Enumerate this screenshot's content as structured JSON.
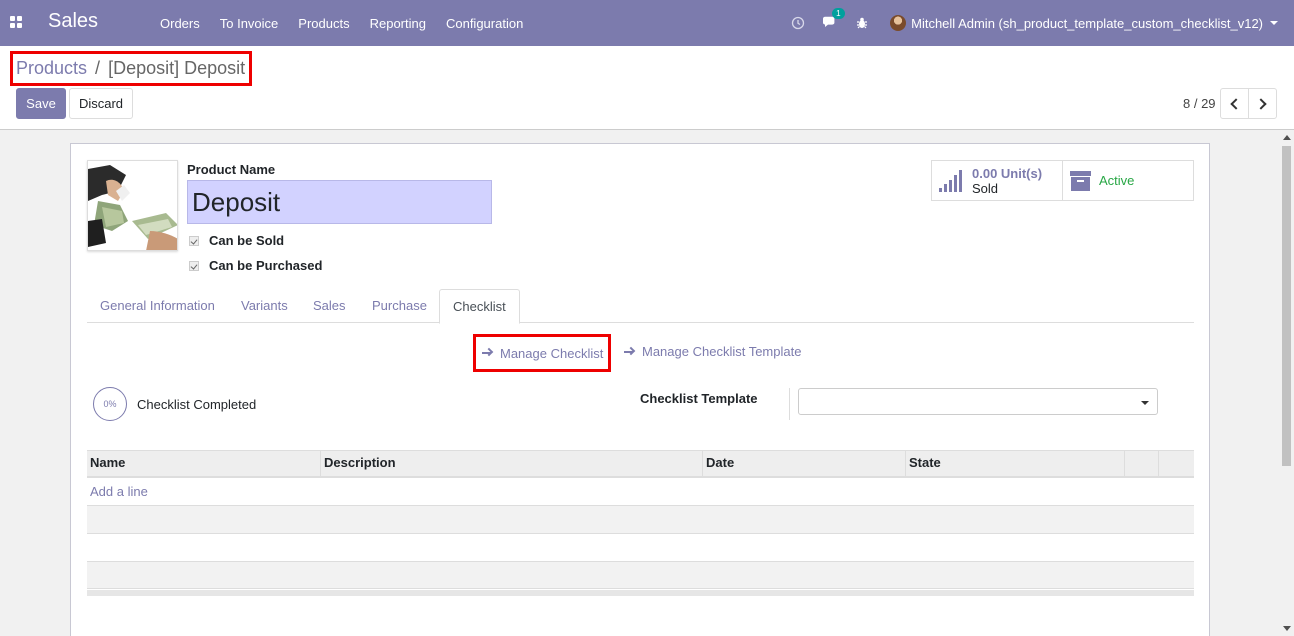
{
  "navbar": {
    "brand": "Sales",
    "menu": [
      "Orders",
      "To Invoice",
      "Products",
      "Reporting",
      "Configuration"
    ],
    "messages_count": "1",
    "user_name": "Mitchell Admin (sh_product_template_custom_checklist_v12)"
  },
  "breadcrumb": {
    "parent": "Products",
    "separator": "/",
    "current": "[Deposit] Deposit"
  },
  "buttons": {
    "save": "Save",
    "discard": "Discard"
  },
  "pager": {
    "value": "8 / 29"
  },
  "product": {
    "name_label": "Product Name",
    "name": "Deposit",
    "can_be_sold_label": "Can be Sold",
    "can_be_sold": true,
    "can_be_purchased_label": "Can be Purchased",
    "can_be_purchased": true
  },
  "stats": {
    "units_value": "0.00 Unit(s)",
    "units_label": "Sold",
    "active_label": "Active"
  },
  "tabs": [
    "General Information",
    "Variants",
    "Sales",
    "Purchase",
    "Checklist"
  ],
  "active_tab": "Checklist",
  "checklist": {
    "manage_checklist": "Manage Checklist",
    "manage_template": "Manage Checklist Template",
    "progress": "0%",
    "completed_label": "Checklist Completed",
    "template_label": "Checklist Template",
    "template_value": ""
  },
  "table": {
    "columns": [
      "Name",
      "Description",
      "Date",
      "State",
      "",
      ""
    ],
    "add_line": "Add a line"
  },
  "colors": {
    "brand": "#7c7bad",
    "active": "#28a745",
    "highlight": "#e00000",
    "name_input_bg": "#d2d2ff"
  }
}
